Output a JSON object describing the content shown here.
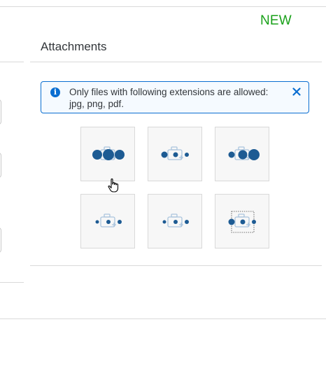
{
  "header": {
    "badge": "NEW"
  },
  "attachments": {
    "title": "Attachments",
    "info": {
      "line1": "Only files with following extensions are allowed:",
      "line2": "jpg, png, pdf."
    },
    "tiles": [
      {
        "name": "attachment-tile-1",
        "state": "loading",
        "icon": "camera-add-icon"
      },
      {
        "name": "attachment-tile-2",
        "state": "loading",
        "icon": "camera-add-icon"
      },
      {
        "name": "attachment-tile-3",
        "state": "loading",
        "icon": "camera-add-icon"
      },
      {
        "name": "attachment-tile-4",
        "state": "loading",
        "icon": "camera-add-icon"
      },
      {
        "name": "attachment-tile-5",
        "state": "loading",
        "icon": "camera-add-icon"
      },
      {
        "name": "attachment-tile-6",
        "state": "loading",
        "icon": "camera-add-icon"
      }
    ]
  },
  "colors": {
    "accent": "#0a6ed1",
    "busy_indicator": "#1d5b93",
    "new_badge": "#1aa11a"
  }
}
